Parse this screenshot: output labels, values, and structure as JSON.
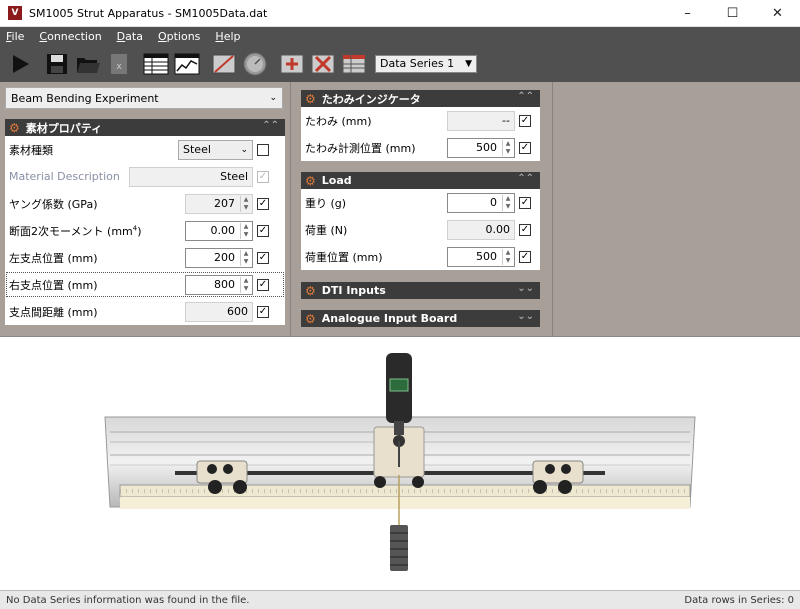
{
  "window": {
    "title": "SM1005 Strut Apparatus - SM1005Data.dat",
    "icon_letter": "V"
  },
  "menu": [
    {
      "label": "File",
      "key": "F"
    },
    {
      "label": "Connection",
      "key": "C"
    },
    {
      "label": "Data",
      "key": "D"
    },
    {
      "label": "Options",
      "key": "O"
    },
    {
      "label": "Help",
      "key": "H"
    }
  ],
  "toolbar": {
    "series_selected": "Data Series 1"
  },
  "experiment": {
    "selected": "Beam Bending Experiment"
  },
  "material": {
    "header": "素材プロパティ",
    "type_label": "素材種類",
    "type_value": "Steel",
    "desc_label": "Material Description",
    "desc_value": "Steel",
    "youngs_label": "ヤング係数 (GPa)",
    "youngs_value": "207",
    "moment_label": "断面2次モーメント (mm",
    "moment_sup": "4",
    "moment_close": ")",
    "moment_value": "0.00",
    "left_label": "左支点位置 (mm)",
    "left_value": "200",
    "right_label": "右支点位置 (mm)",
    "right_value": "800",
    "span_label": "支点間距離 (mm)",
    "span_value": "600"
  },
  "deflection": {
    "header": "たわみインジケータ",
    "deflection_label": "たわみ (mm)",
    "deflection_value": "--",
    "position_label": "たわみ計測位置 (mm)",
    "position_value": "500"
  },
  "load": {
    "header": "Load",
    "mass_label": "重り (g)",
    "mass_value": "0",
    "force_label": "荷重 (N)",
    "force_value": "0.00",
    "position_label": "荷重位置 (mm)",
    "position_value": "500"
  },
  "dti": {
    "header": "DTI Inputs"
  },
  "aib": {
    "header": "Analogue Input Board"
  },
  "status": {
    "message": "No Data Series information was found in the file.",
    "rows": "Data rows in Series: 0"
  },
  "colors": {
    "accent": "#e07a3a",
    "header_bg": "#3c3c3c",
    "menu_bg": "#505050",
    "panel_bg": "#a89f98"
  }
}
